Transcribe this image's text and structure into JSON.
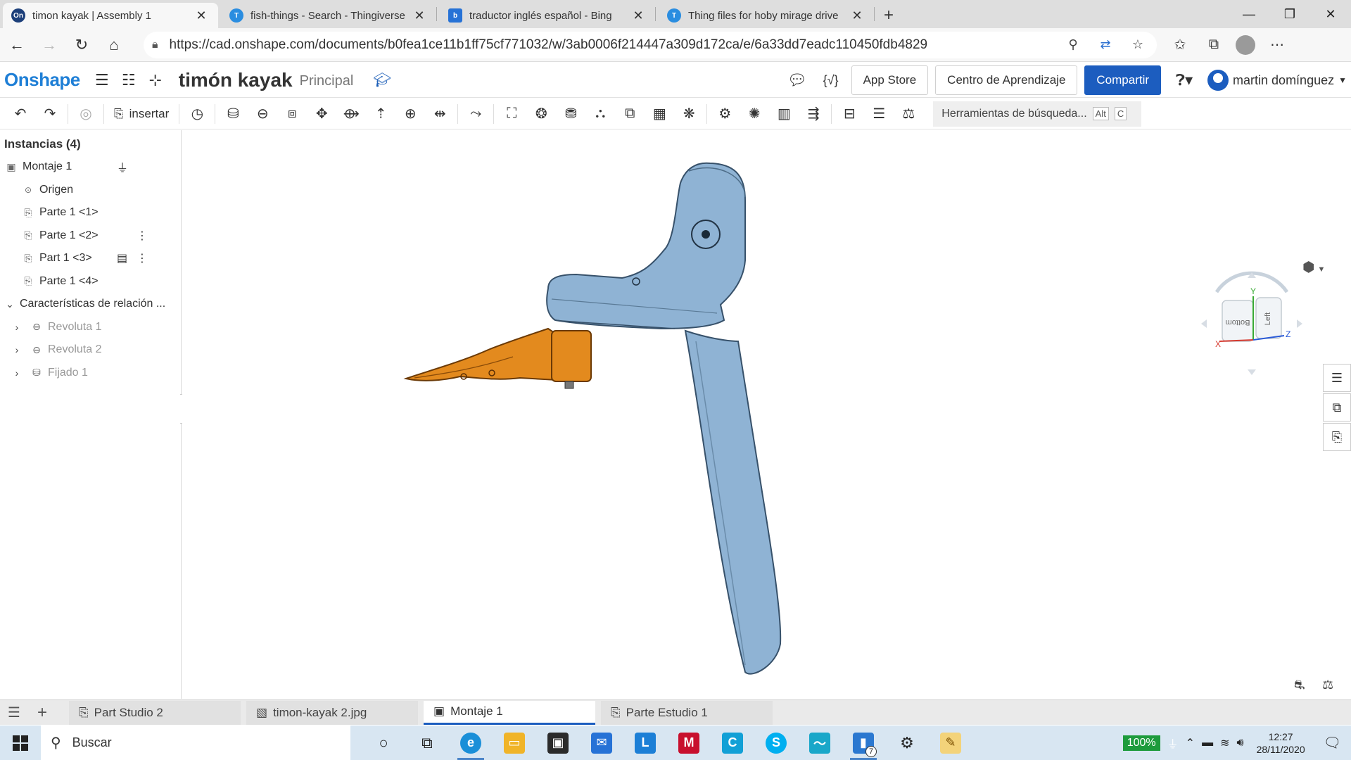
{
  "browser": {
    "tabs": [
      {
        "label": "timon kayak | Assembly 1",
        "fav": "On",
        "fav_color": "#1c3f7a",
        "active": true
      },
      {
        "label": "fish-things - Search - Thingiverse",
        "fav": "T",
        "fav_color": "#2a8de0",
        "active": false
      },
      {
        "label": "traductor inglés español - Bing",
        "fav": "b",
        "fav_color": "#2672d6",
        "active": false
      },
      {
        "label": "Thing files for hoby mirage drive",
        "fav": "T",
        "fav_color": "#2a8de0",
        "active": false
      }
    ],
    "url": "https://cad.onshape.com/documents/b0fea1ce11b1ff75cf771032/w/3ab0006f214447a309d172ca/e/6a33dd7eadc110450fdb4829"
  },
  "header": {
    "logo": "Onshape",
    "doc_title": "timón kayak",
    "branch": "Principal",
    "app_store": "App Store",
    "learning_center": "Centro de Aprendizaje",
    "share": "Compartir",
    "user_name": "martin domínguez"
  },
  "toolbar": {
    "insert_label": "insertar",
    "search_tools": "Herramientas de búsqueda...",
    "shortcut_alt": "Alt",
    "shortcut_key": "C"
  },
  "instances": {
    "title": "Instancias (4)",
    "assembly": "Montaje 1",
    "origin": "Origen",
    "parts": [
      "Parte 1 <1>",
      "Parte 1 <2>",
      "Part 1 <3>",
      "Parte 1 <4>"
    ],
    "mates_group": "Características de relación ...",
    "mates": [
      "Revoluta 1",
      "Revoluta 2",
      "Fijado 1"
    ]
  },
  "viewcube": {
    "face_bottom": "Bottom",
    "face_left": "Left",
    "axis_x": "X",
    "axis_y": "Y",
    "axis_z": "Z"
  },
  "bottom_tabs": [
    "Part Studio 2",
    "timon-kayak 2.jpg",
    "Montaje 1",
    "Parte Estudio 1"
  ],
  "taskbar": {
    "search": "Buscar",
    "battery": "100%",
    "time": "12:27",
    "date": "28/11/2020",
    "badge_count": "7"
  },
  "colors": {
    "accent": "#1c5dbf",
    "part_blue": "#8fb3d4",
    "part_orange": "#e38a1e"
  }
}
